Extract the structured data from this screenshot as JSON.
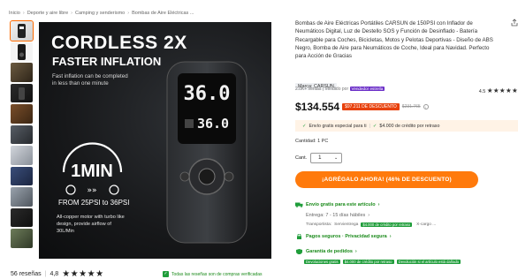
{
  "breadcrumb": [
    "Inicio",
    "Deporte y aire libre",
    "Camping y senderismo",
    "Bombas de Aire Eléctricas ..."
  ],
  "hero": {
    "headline": "CORDLESS 2X",
    "subheadline": "FASTER INFLATION",
    "tagline": "Fast inflation can be completed in less than one minute",
    "time_value": "1MIN",
    "from_text": "FROM 25PSI to 36PSI",
    "description": "All-copper motor with turbo like design, provide airflow of 30L/Min",
    "display_top": "36.0",
    "display_bottom": "36.0"
  },
  "reviews": {
    "count_text": "56 reseñas",
    "rating": "4,8",
    "stars": "★★★★★",
    "verified_text": "Todas las reseñas son de compras verificadas"
  },
  "product": {
    "title": "Bombas de Aire Eléctricas Portátiles CARSUN de 150PSI con Inflador de Neumáticos Digital, Luz de Destello SOS y Función de Desinflado - Batería Recargable para Coches, Bicicletas, Motos y Pelotas Deportivas - Diseño de ABS Negro, Bomba de Aire para Neumáticos de Coche, Ideal para Navidad. Perfecto para Acción de Gracias",
    "brand": "Marca: CARSUN",
    "sales": "2.0K+ ventas",
    "sold_by": "Vendido por",
    "seller_badge": "Vendedor estrella",
    "rating": "4.5",
    "stars": "★★★★★",
    "price": "$134.554",
    "discount": "$97.211 DE DESCUENTO",
    "old_price": "$231.765",
    "promo_left": "Envío gratis especial para ti",
    "promo_sep": "|",
    "promo_right": "$4.000 de crédito por retraso",
    "qty_label": "Cantidad: 1 PC",
    "cant_label": "Cant.",
    "qty_value": "1",
    "buy_button": "¡AGRÉGALO AHORA! (46% DE DESCUENTO)"
  },
  "shipping": {
    "free_ship": "Envío gratis para este artículo",
    "delivery": "Entrega: 7 - 15 días hábiles",
    "carrier_label": "Transportista:",
    "carrier_value": "Servientrega",
    "carrier_more": "X-cargo ...",
    "credit_chip": "$4.000 de crédito por retraso",
    "safe_pay": "Pagos seguros · Privacidad segura",
    "guarantee": "Garantía de pedidos",
    "chips": [
      "Devoluciones gratis",
      "$4.000 de crédito por retraso",
      "Devolución si el artículo está dañado"
    ]
  },
  "colors": {
    "accent": "#ff7a0c",
    "price_badge": "#e8410c",
    "green": "#1f9d3a",
    "seller_purple": "#6b2fc8"
  }
}
